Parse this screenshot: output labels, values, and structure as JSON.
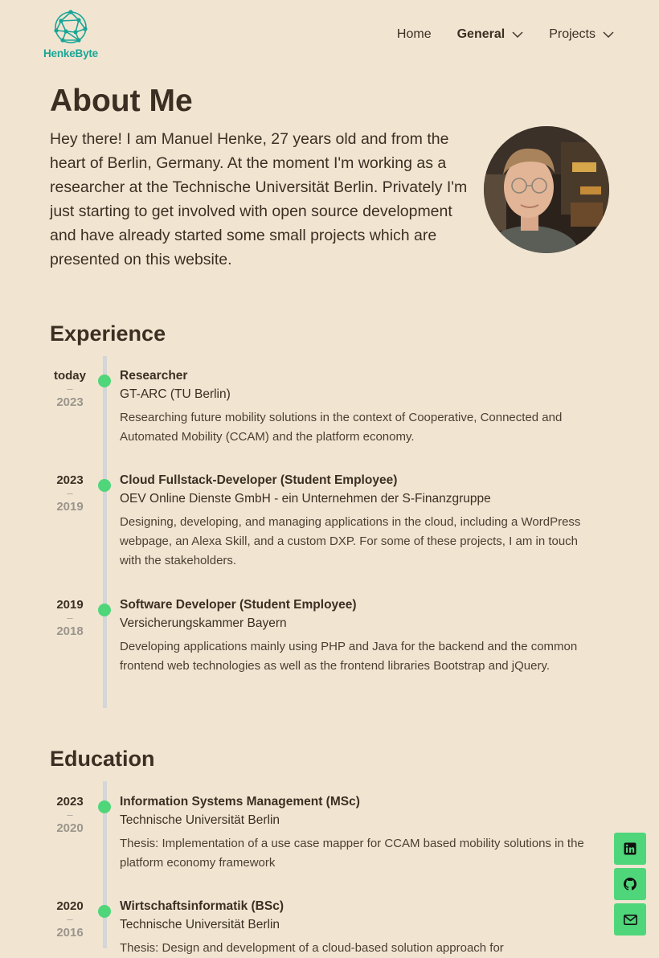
{
  "brand": {
    "name": "HenkeByte",
    "logo_icon": "network-globe-icon",
    "color": "#1aa596"
  },
  "nav": {
    "items": [
      {
        "label": "Home",
        "active": false,
        "dropdown": false
      },
      {
        "label": "General",
        "active": true,
        "dropdown": true
      },
      {
        "label": "Projects",
        "active": false,
        "dropdown": true
      }
    ]
  },
  "about": {
    "title": "About Me",
    "text": "Hey there! I am Manuel Henke, 27 years old and from the heart of Berlin, Germany. At the moment I'm working as a researcher at the Technische Universität Berlin. Privately I'm just starting to get involved with open source development and have already started some small projects which are presented on this website."
  },
  "experience": {
    "title": "Experience",
    "entries": [
      {
        "end": "today",
        "start": "2023",
        "role": "Researcher",
        "org": "GT-ARC (TU Berlin)",
        "desc": "Researching future mobility solutions in the context of Cooperative, Connected and Automated Mobility (CCAM) and the platform economy."
      },
      {
        "end": "2023",
        "start": "2019",
        "role": "Cloud Fullstack-Developer (Student Employee)",
        "org": "OEV Online Dienste GmbH - ein Unternehmen der S-Finanzgruppe",
        "desc": "Designing, developing, and managing applications in the cloud, including a WordPress webpage, an Alexa Skill, and a custom DXP. For some of these projects, I am in touch with the stakeholders."
      },
      {
        "end": "2019",
        "start": "2018",
        "role": "Software Developer (Student Employee)",
        "org": "Versicherungskammer Bayern",
        "desc": "Developing applications mainly using PHP and Java for the backend and the common frontend web technologies as well as the frontend libraries Bootstrap and jQuery."
      }
    ]
  },
  "education": {
    "title": "Education",
    "entries": [
      {
        "end": "2023",
        "start": "2020",
        "role": "Information Systems Management (MSc)",
        "org": "Technische Universität Berlin",
        "desc": "Thesis: Implementation of a use case mapper for CCAM based mobility solutions in the platform economy framework"
      },
      {
        "end": "2020",
        "start": "2016",
        "role": "Wirtschaftsinformatik (BSc)",
        "org": "Technische Universität Berlin",
        "desc": "Thesis: Design and development of a cloud-based solution approach for"
      }
    ]
  },
  "separator": "–",
  "social": [
    {
      "icon": "linkedin-icon"
    },
    {
      "icon": "github-icon"
    },
    {
      "icon": "mail-icon"
    }
  ],
  "colors": {
    "background": "#f1e5d2",
    "accent": "#4fd67a",
    "text": "#3a2f22",
    "timeline": "#d4d6d8"
  }
}
